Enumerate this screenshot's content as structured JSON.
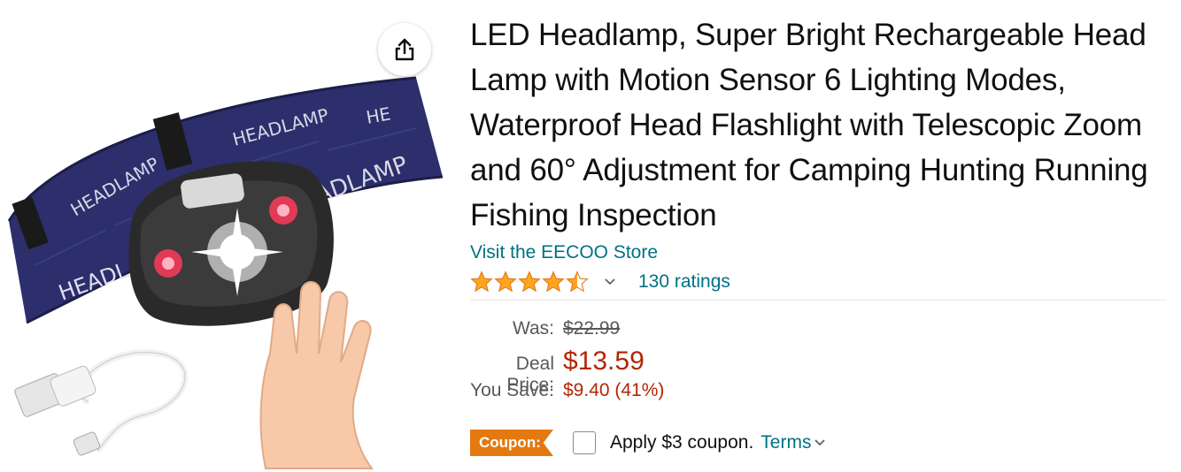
{
  "product": {
    "title": "LED Headlamp, Super Bright Rechargeable Head Lamp with Motion Sensor 6 Lighting Modes, Waterproof Head Flashlight with Telescopic Zoom and 60° Adjustment for Camping Hunting Running Fishing Inspection",
    "store_link": "Visit the EECOO Store",
    "rating": {
      "stars": 4.5,
      "count_label": "130 ratings"
    },
    "image": {
      "band_text": [
        "HEADLAMP",
        "HEADLAMP",
        "HEADL",
        "HE",
        "ADLAMP"
      ]
    }
  },
  "pricing": {
    "was_label": "Was:",
    "was_value": "$22.99",
    "deal_label": "Deal Price:",
    "deal_value": "$13.59",
    "save_label": "You Save:",
    "save_value": "$9.40 (41%)"
  },
  "coupon": {
    "badge": "Coupon:",
    "text": "Apply $3 coupon.",
    "terms": "Terms"
  },
  "colors": {
    "link": "#007185",
    "price": "#b12704",
    "star": "#ffa41c",
    "coupon_badge": "#e47911"
  },
  "icons": {
    "share": "share-icon",
    "star": "star-icon",
    "chevron": "chevron-down-icon"
  }
}
